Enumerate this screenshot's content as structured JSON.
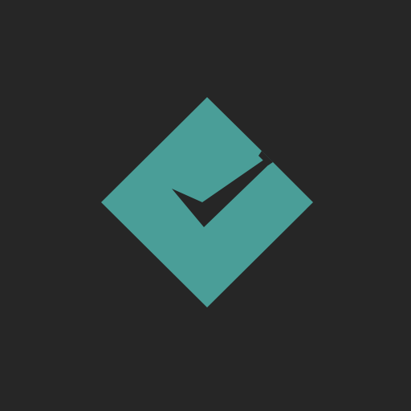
{
  "app_icon": {
    "icon": "diamond-checkmark-icon",
    "colors": {
      "background": "#262626",
      "diamond": "#4A9E98",
      "checkmark": "#262626"
    }
  }
}
